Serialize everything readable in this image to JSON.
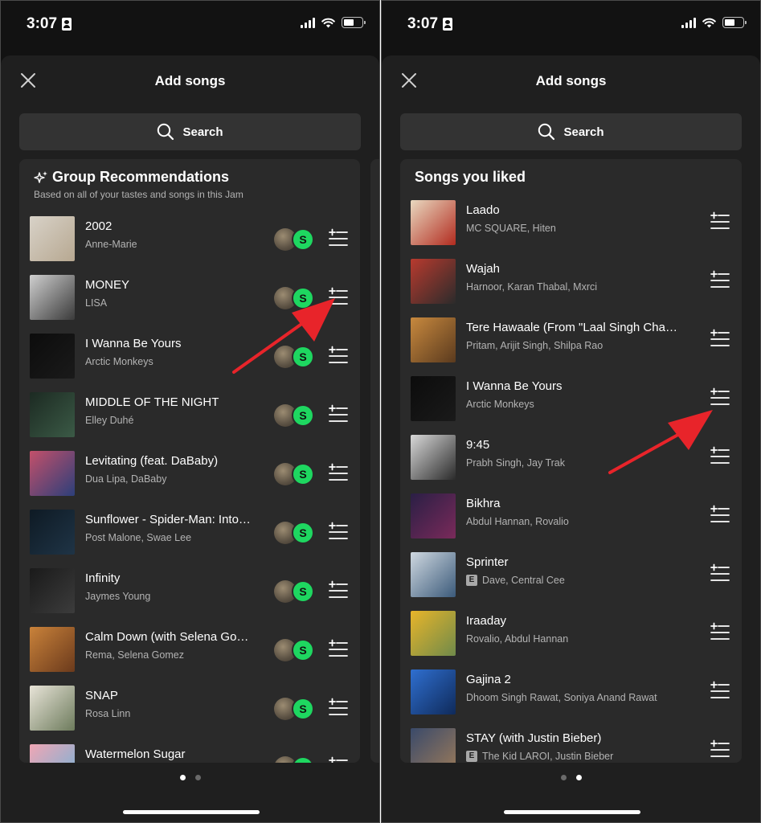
{
  "left": {
    "status": {
      "time": "3:07"
    },
    "header": {
      "title": "Add songs",
      "close_icon": "close-icon"
    },
    "search": {
      "label": "Search",
      "icon": "search-icon"
    },
    "section": {
      "title": "Group Recommendations",
      "subtitle": "Based on all of your tastes and songs in this Jam",
      "icon": "sparkle-icon"
    },
    "tracks": [
      {
        "title": "2002",
        "artist": "Anne-Marie",
        "art": [
          "#d8d2c8",
          "#b7a891"
        ]
      },
      {
        "title": "MONEY",
        "artist": "LISA",
        "art": [
          "#cfcfcf",
          "#3a3a3a"
        ]
      },
      {
        "title": "I Wanna Be Yours",
        "artist": "Arctic Monkeys",
        "art": [
          "#0c0c0c",
          "#1a1a1a"
        ]
      },
      {
        "title": "MIDDLE OF THE NIGHT",
        "artist": "Elley Duhé",
        "art": [
          "#1c2a22",
          "#3b5a46"
        ]
      },
      {
        "title": "Levitating (feat. DaBaby)",
        "artist": "Dua Lipa, DaBaby",
        "art": [
          "#c3506a",
          "#2c3f7a"
        ]
      },
      {
        "title": "Sunflower - Spider-Man: Into…",
        "artist": "Post Malone, Swae Lee",
        "art": [
          "#0e1a24",
          "#1f3446"
        ]
      },
      {
        "title": "Infinity",
        "artist": "Jaymes Young",
        "art": [
          "#1a1a1a",
          "#3c3c3c"
        ]
      },
      {
        "title": "Calm Down (with Selena Go…",
        "artist": "Rema, Selena Gomez",
        "art": [
          "#c9823a",
          "#6b3a1c"
        ]
      },
      {
        "title": "SNAP",
        "artist": "Rosa Linn",
        "art": [
          "#e8e4d8",
          "#6d7b5c"
        ]
      },
      {
        "title": "Watermelon Sugar",
        "artist": "",
        "art": [
          "#f0a6b4",
          "#6fb3d9"
        ]
      }
    ],
    "collaborator": {
      "initial": "S",
      "color": "#1ed760"
    },
    "pager": {
      "active": 0,
      "count": 2
    }
  },
  "right": {
    "status": {
      "time": "3:07"
    },
    "header": {
      "title": "Add songs",
      "close_icon": "close-icon"
    },
    "search": {
      "label": "Search",
      "icon": "search-icon"
    },
    "section": {
      "title": "Songs you liked"
    },
    "tracks": [
      {
        "title": "Laado",
        "artist": "MC SQUARE, Hiten",
        "explicit": false,
        "art": [
          "#e9d9c0",
          "#b22b1f"
        ]
      },
      {
        "title": "Wajah",
        "artist": "Harnoor, Karan Thabal, Mxrci",
        "explicit": false,
        "art": [
          "#b83a2e",
          "#2b2b2b"
        ]
      },
      {
        "title": "Tere Hawaale (From \"Laal Singh Cha…",
        "artist": "Pritam, Arijit Singh, Shilpa Rao",
        "explicit": false,
        "art": [
          "#c8893e",
          "#5a3a1e"
        ]
      },
      {
        "title": "I Wanna Be Yours",
        "artist": "Arctic Monkeys",
        "explicit": false,
        "art": [
          "#0c0c0c",
          "#1a1a1a"
        ]
      },
      {
        "title": "9:45",
        "artist": "Prabh Singh, Jay Trak",
        "explicit": false,
        "art": [
          "#d9d9d9",
          "#2a2a2a"
        ]
      },
      {
        "title": "Bikhra",
        "artist": "Abdul Hannan, Rovalio",
        "explicit": false,
        "art": [
          "#2a1f45",
          "#7a2a5a"
        ]
      },
      {
        "title": "Sprinter",
        "artist": "Dave, Central Cee",
        "explicit": true,
        "art": [
          "#cfd8e0",
          "#3b5a7a"
        ]
      },
      {
        "title": "Iraaday",
        "artist": "Rovalio, Abdul Hannan",
        "explicit": false,
        "art": [
          "#e8b52a",
          "#6f8a4a"
        ]
      },
      {
        "title": "Gajina 2",
        "artist": "Dhoom Singh Rawat, Soniya Anand Rawat",
        "explicit": false,
        "art": [
          "#2f6fd0",
          "#0f2a5a"
        ]
      },
      {
        "title": "STAY (with Justin Bieber)",
        "artist": "The Kid LAROI, Justin Bieber",
        "explicit": true,
        "art": [
          "#3a4a6a",
          "#9a7a5a"
        ]
      }
    ],
    "pager": {
      "active": 1,
      "count": 2
    }
  },
  "explicit_badge": "E",
  "add_icon": "add-to-queue-icon",
  "annotation_arrow_color": "#e8242a"
}
